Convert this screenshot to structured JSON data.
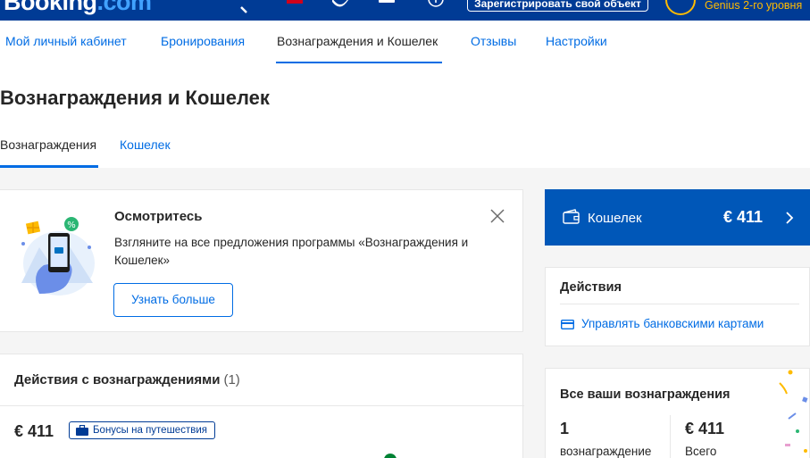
{
  "header": {
    "logo_main": "Booking",
    "logo_dot": ".com",
    "register_button": "Зарегистрировать свой объект",
    "genius_level": "Genius 2-го уровня"
  },
  "nav": {
    "items": [
      {
        "label": "Мой личный кабинет"
      },
      {
        "label": "Бронирования"
      },
      {
        "label": "Вознаграждения и Кошелек"
      },
      {
        "label": "Отзывы"
      },
      {
        "label": "Настройки"
      }
    ]
  },
  "page": {
    "title": "Вознаграждения и Кошелек",
    "subtabs": [
      {
        "label": "Вознаграждения"
      },
      {
        "label": "Кошелек"
      }
    ]
  },
  "promo": {
    "title": "Осмотритесь",
    "text": "Взгляните на все предложения программы «Вознаграждения и Кошелек»",
    "button": "Узнать больше"
  },
  "reward_actions": {
    "title": "Действия с вознаграждениями",
    "count": "(1)",
    "amount": "€ 411",
    "badge": "Бонусы на путешествия"
  },
  "wallet": {
    "label": "Кошелек",
    "amount": "€ 411"
  },
  "actions": {
    "title": "Действия",
    "manage_cards": "Управлять банковскими картами"
  },
  "all_rewards": {
    "title": "Все ваши вознаграждения",
    "count_value": "1",
    "count_label": "вознаграждение",
    "total_value": "€ 411",
    "total_label": "Всего"
  },
  "colors": {
    "brand_dark": "#003b95",
    "brand_link": "#006ce4",
    "wallet_bg": "#0057b8",
    "genius": "#febb02"
  }
}
